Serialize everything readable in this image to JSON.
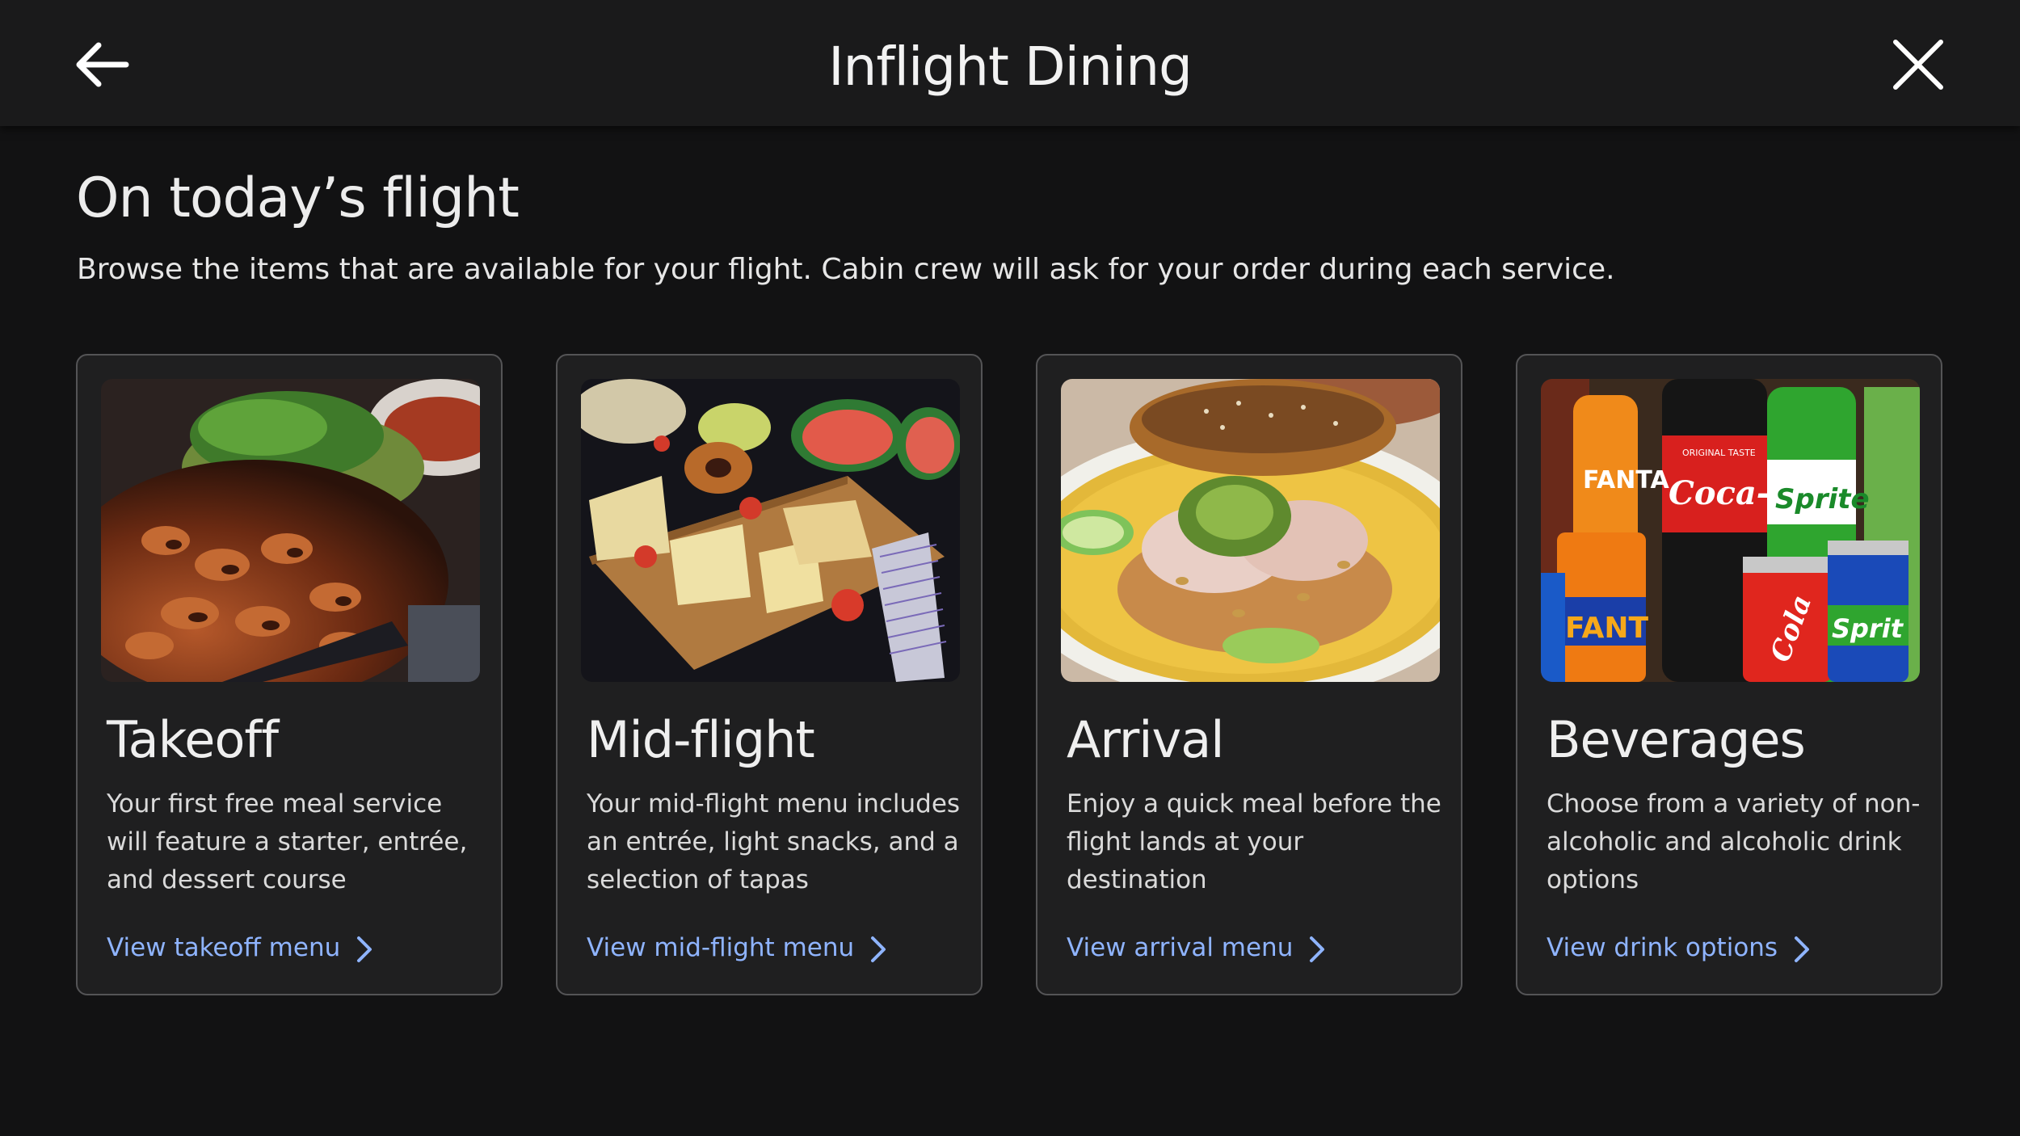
{
  "header": {
    "title": "Inflight Dining",
    "back_icon": "arrow-left-icon",
    "close_icon": "close-icon"
  },
  "main": {
    "heading": "On today’s flight",
    "subheading": "Browse the items that are available for your flight. Cabin crew will ask for your order during each service."
  },
  "cards": [
    {
      "title": "Takeoff",
      "description": "Your first free meal service will feature a starter, entrée, and dessert course",
      "link": "View takeoff menu"
    },
    {
      "title": "Mid-flight",
      "description": "Your mid-flight menu includes an entrée, light snacks, and a selection of tapas",
      "link": "View mid-flight menu"
    },
    {
      "title": "Arrival",
      "description": "Enjoy a quick meal before the flight lands at your destination",
      "link": "View arrival menu"
    },
    {
      "title": "Beverages",
      "description": "Choose from a variety of non-alcoholic and alcoholic drink options",
      "link": "View drink options"
    }
  ],
  "colors": {
    "background": "#121213",
    "header": "#1a1a1b",
    "card": "#1f1f20",
    "card_border": "#545456",
    "link": "#8fb4ff",
    "text": "#ececec"
  }
}
